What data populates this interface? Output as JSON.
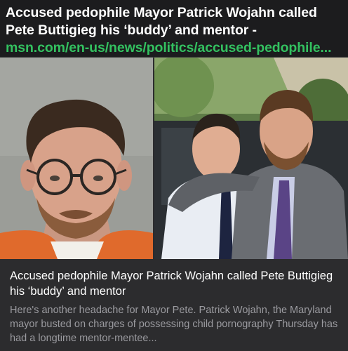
{
  "post": {
    "text": "Accused pedophile Mayor Patrick Wojahn called Pete Buttigieg his ‘buddy’ and mentor - ",
    "link": "msn.com/en-us/news/politics/accused-pedophile..."
  },
  "card": {
    "title": "Accused pedophile Mayor Patrick Wojahn called Pete Buttigieg his ‘buddy’ and mentor",
    "description": "Here's another headache for Mayor Pete. Patrick Wojahn, the Maryland mayor busted on charges of possessing child pornography Thursday has had a longtime mentor-mentee..."
  },
  "colors": {
    "background": "#1c1c1e",
    "card": "#2c2c2e",
    "link": "#33c160",
    "description": "#9b9ba0"
  }
}
